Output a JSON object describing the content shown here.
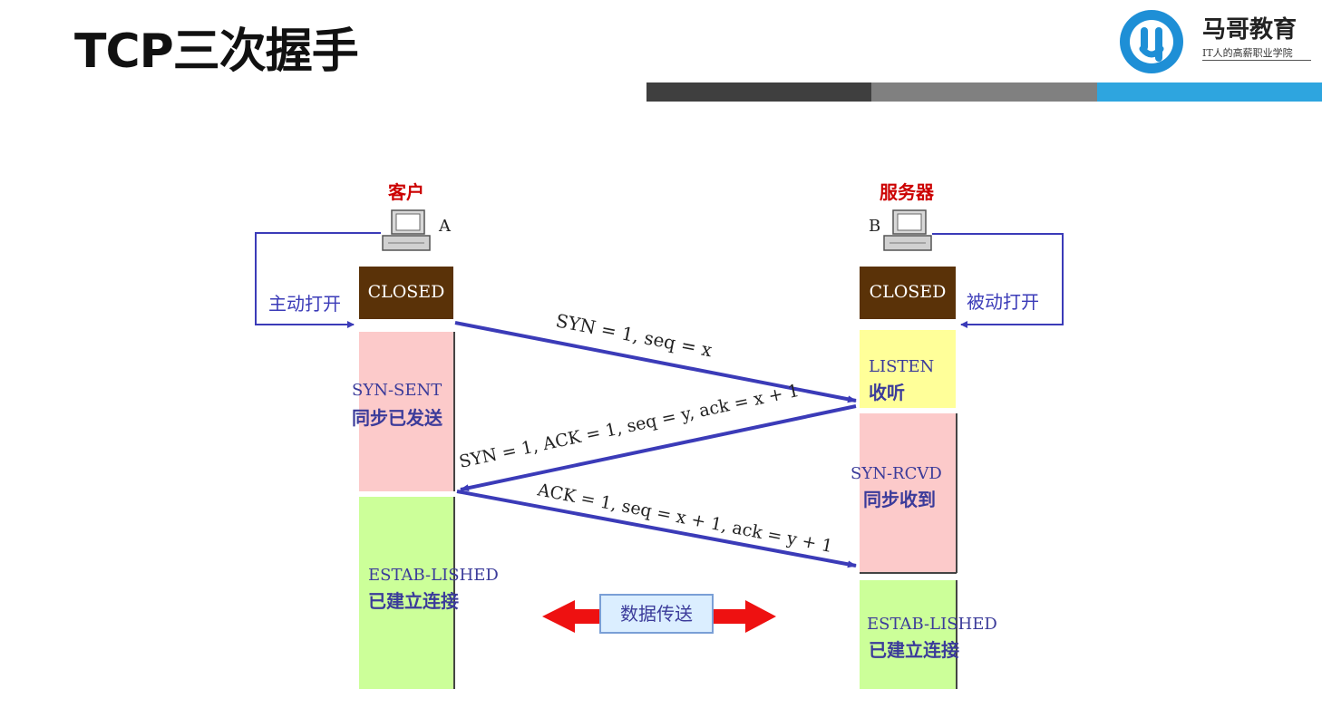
{
  "page": {
    "title": "TCP三次握手"
  },
  "logo": {
    "name": "马哥教育",
    "slogan": "IT人的高薪职业学院",
    "icon": "mage-logo-icon",
    "colors": {
      "ring": "#1e8fd6"
    }
  },
  "header_bar": {
    "colors": [
      "#3f3f3f",
      "#808080",
      "#2ea5df"
    ]
  },
  "diagram": {
    "client": {
      "label": "客户",
      "host": "A",
      "open_label": "主动打开",
      "states": {
        "closed": "CLOSED",
        "syn_sent": "SYN-SENT",
        "syn_sent_cn": "同步已发送",
        "established": "ESTAB-LISHED",
        "established_cn": "已建立连接"
      }
    },
    "server": {
      "label": "服务器",
      "host": "B",
      "open_label": "被动打开",
      "states": {
        "closed": "CLOSED",
        "listen": "LISTEN",
        "listen_cn": "收听",
        "syn_rcvd": "SYN-RCVD",
        "syn_rcvd_cn": "同步收到",
        "established": "ESTAB-LISHED",
        "established_cn": "已建立连接"
      }
    },
    "messages": {
      "msg1": "SYN = 1, seq = x",
      "msg2": "SYN = 1, ACK = 1, seq = y, ack = x + 1",
      "msg3": "ACK = 1, seq = x + 1, ack = y + 1"
    },
    "data_transfer": "数据传送",
    "colors": {
      "closed": "#5a3208",
      "syn": "#fccaca",
      "listen": "#ffff99",
      "established": "#ccff99",
      "arrow": "#3b3bb8",
      "label_red": "#cc0000",
      "data_arrow": "#ee1111"
    }
  }
}
